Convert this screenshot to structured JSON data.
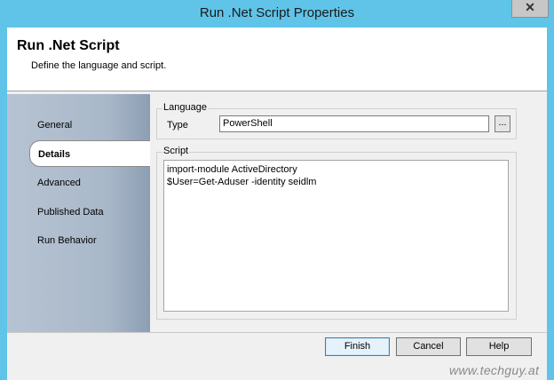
{
  "window": {
    "title": "Run .Net Script Properties",
    "close_icon": "close-icon",
    "close_glyph": "✕"
  },
  "header": {
    "title": "Run .Net Script",
    "subtitle": "Define the language and script."
  },
  "nav": {
    "items": [
      {
        "label": "General",
        "selected": false
      },
      {
        "label": "Details",
        "selected": true
      },
      {
        "label": "Advanced",
        "selected": false
      },
      {
        "label": "Published Data",
        "selected": false
      },
      {
        "label": "Run Behavior",
        "selected": false
      }
    ]
  },
  "language": {
    "group_label": "Language",
    "type_label": "Type",
    "type_value": "PowerShell",
    "browse_label": "..."
  },
  "script": {
    "group_label": "Script",
    "lines": [
      "import-module ActiveDirectory",
      "$User=Get-Aduser -identity seidlm"
    ]
  },
  "buttons": {
    "finish": "Finish",
    "cancel": "Cancel",
    "help": "Help"
  },
  "watermark": "www.techguy.at"
}
